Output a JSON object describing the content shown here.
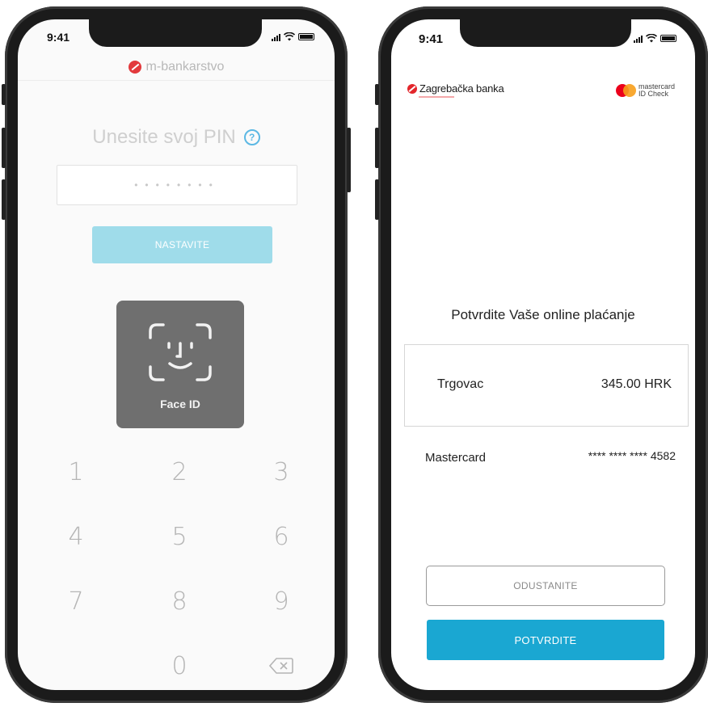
{
  "left_phone": {
    "status_time": "9:41",
    "app_name": "m-bankarstvo",
    "pin_title": "Unesite svoj PIN",
    "pin_dots": "••••••••",
    "continue_label": "NASTAVITE",
    "faceid_label": "Face ID",
    "keypad": {
      "k1": "1",
      "k2": "2",
      "k3": "3",
      "k4": "4",
      "k5": "5",
      "k6": "6",
      "k7": "7",
      "k8": "8",
      "k9": "9",
      "k0": "0"
    },
    "colors": {
      "accent": "#5cb8e4",
      "button": "#9fdcea",
      "faceid_bg": "#6f6f6f",
      "logo": "#e2393c"
    }
  },
  "right_phone": {
    "status_time": "9:41",
    "bank_name": "Zagrebačka banka",
    "mc_brand_line1": "mastercard",
    "mc_brand_line2": "ID Check",
    "confirm_title": "Potvrdite Vaše online plaćanje",
    "merchant_label": "Trgovac",
    "amount": "345.00 HRK",
    "card_label": "Mastercard",
    "card_number": "**** **** **** 4582",
    "cancel_label": "ODUSTANITE",
    "confirm_label": "POTVRDITE",
    "colors": {
      "primary": "#1aa7d2",
      "bank_red": "#e3262b",
      "mc_red": "#eb001b",
      "mc_yellow": "#f79e1b"
    }
  }
}
